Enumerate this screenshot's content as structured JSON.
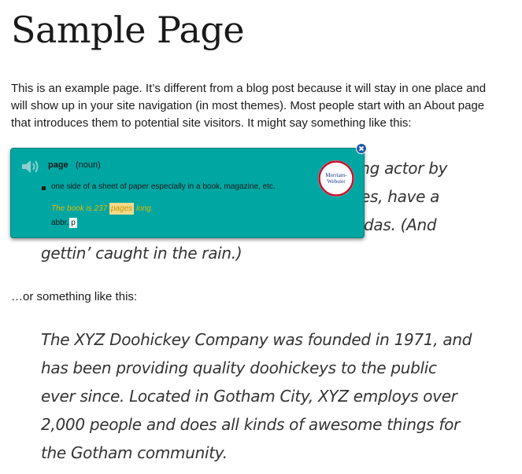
{
  "page": {
    "title": "Sample Page",
    "intro": "This is an example page. It’s different from a blog post because it will stay in one place and will show up in your site navigation (in most themes). Most people start with an About page that introduces them to potential site visitors. It might say something like this:",
    "quote1_visible_lines": [
      "ing actor by",
      "es, have a",
      "das. (And",
      "gettin’ caught in the rain.)"
    ],
    "transition": "…or something like this:",
    "quote2_lines": [
      "The XYZ Doohickey Company was founded in 1971, and",
      "has been providing quality doohickeys to the public",
      "ever since. Located in Gotham City, XYZ employs over",
      "2,000 people and does all kinds of awesome things for",
      "the Gotham community."
    ]
  },
  "popup": {
    "headword": "page",
    "part_of_speech": "(noun)",
    "definition": "one side of a sheet of paper especially in a book, magazine, etc.",
    "example_before": "The book is 237 ",
    "example_highlight": "pages",
    "example_after": " long.",
    "abbr_label": "abbr.",
    "abbr_value": "p",
    "logo_line1": "Merriam-",
    "logo_line2": "Webster",
    "speaker_icon": "speaker-icon",
    "close_icon": "close-icon"
  },
  "colors": {
    "popup_bg": "#00a6a2",
    "example_text": "#e6b800",
    "highlight_bg": "#f3d98a",
    "logo_red": "#c8102e",
    "logo_blue": "#1d3f8f"
  }
}
